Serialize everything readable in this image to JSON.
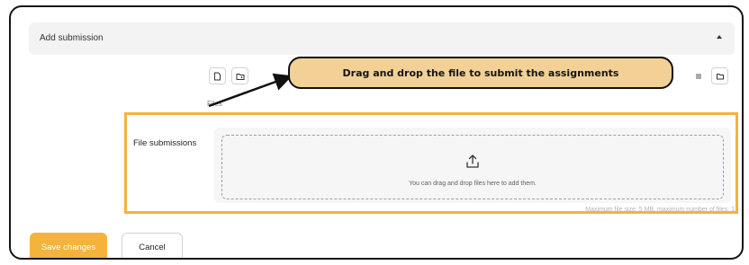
{
  "section": {
    "title": "Add submission"
  },
  "filepicker": {
    "files_label": "Files",
    "toolbar_left_icons": [
      "add-file-icon",
      "create-folder-icon"
    ],
    "toolbar_right_icons": [
      "list-view-icon",
      "folder-view-icon"
    ]
  },
  "callout": {
    "text": "Drag and drop the file to submit the assignments"
  },
  "file_submissions": {
    "label": "File submissions",
    "drop_hint": "You can drag and drop files here to add them.",
    "max_note": "Maximum file size: 5 MB, maximum number of files: 1"
  },
  "actions": {
    "save_label": "Save changes",
    "cancel_label": "Cancel"
  },
  "colors": {
    "accent": "#f4b33b",
    "highlight_border": "#f2b33f",
    "callout_fill": "#f3d196"
  }
}
